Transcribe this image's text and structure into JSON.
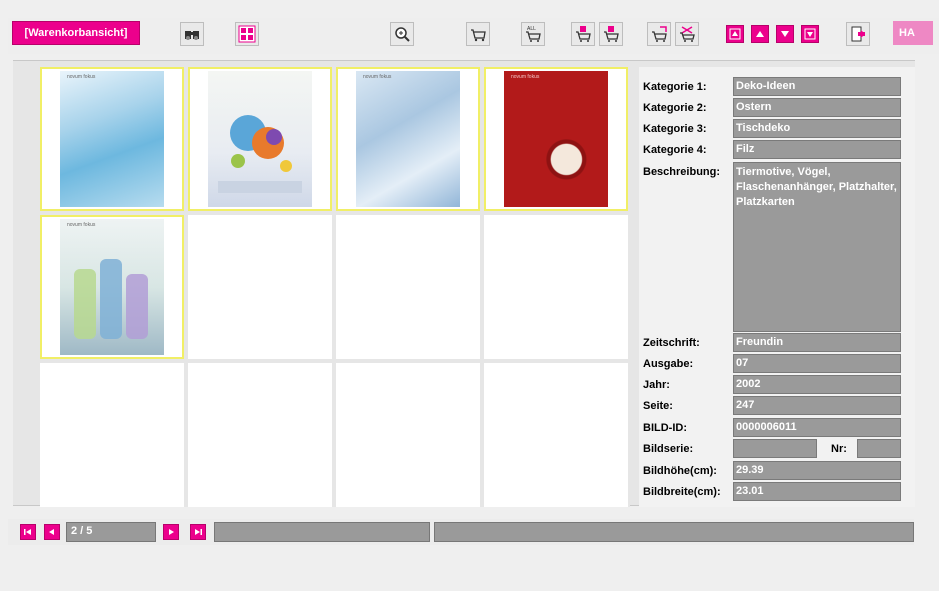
{
  "toolbar": {
    "warenkorb_label": "[Warenkorbansicht]",
    "ha_label": "HA"
  },
  "thumbnails": [
    {
      "tag": "novum fokus",
      "palette": "blue"
    },
    {
      "tag": "",
      "palette": "felt-bird"
    },
    {
      "tag": "novum fokus",
      "palette": "blue-napkin"
    },
    {
      "tag": "novum fokus",
      "palette": "red-table"
    },
    {
      "tag": "novum fokus",
      "palette": "bottles"
    }
  ],
  "details": {
    "kategorie1_label": "Kategorie 1:",
    "kategorie1": "Deko-Ideen",
    "kategorie2_label": "Kategorie 2:",
    "kategorie2": "Ostern",
    "kategorie3_label": "Kategorie 3:",
    "kategorie3": "Tischdeko",
    "kategorie4_label": "Kategorie 4:",
    "kategorie4": "Filz",
    "beschreibung_label": "Beschreibung:",
    "beschreibung": "Tiermotive, Vögel, Flaschenanhänger, Platzhalter, Platzkarten",
    "zeitschrift_label": "Zeitschrift:",
    "zeitschrift": "Freundin",
    "ausgabe_label": "Ausgabe:",
    "ausgabe": "07",
    "jahr_label": "Jahr:",
    "jahr": "2002",
    "seite_label": "Seite:",
    "seite": "247",
    "bildid_label": "BILD-ID:",
    "bildid": "0000006011",
    "bildserie_label": "Bildserie:",
    "bildserie": "",
    "nr_label": "Nr:",
    "nr": "",
    "bildhoehe_label": "Bildhöhe(cm):",
    "bildhoehe": "29.39",
    "bildbreite_label": "Bildbreite(cm):",
    "bildbreite": "23.01"
  },
  "nav": {
    "page": "2 / 5",
    "status1": "",
    "status2": ""
  },
  "colors": {
    "accent": "#ec008c",
    "selection_border": "#f1ef66",
    "field_bg": "#9a9a9a"
  }
}
